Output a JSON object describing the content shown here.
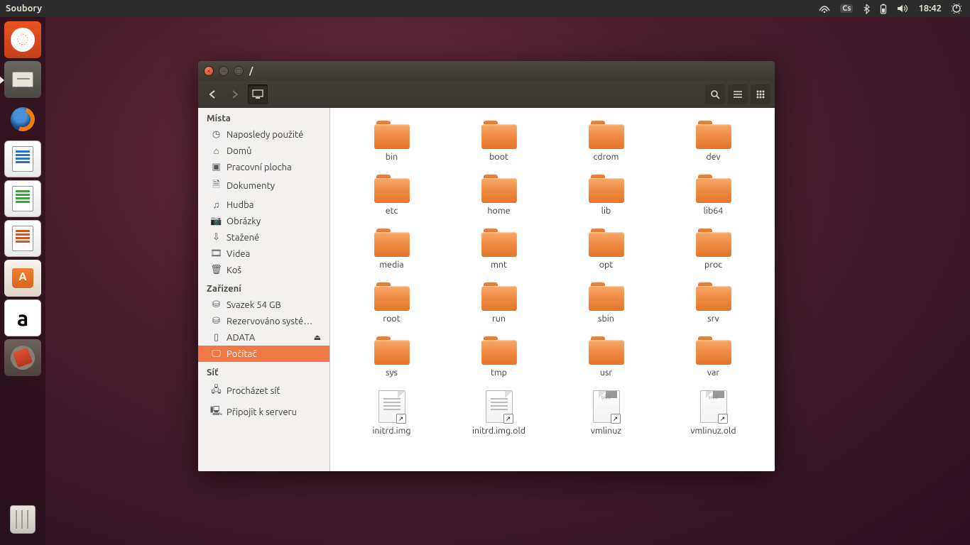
{
  "panel": {
    "app": "Soubory",
    "kbd": "Cs",
    "time": "18:42"
  },
  "window": {
    "title": "/"
  },
  "sidebar": {
    "sections": [
      {
        "head": "Místa",
        "items": [
          {
            "icon": "clock",
            "label": "Naposledy použité"
          },
          {
            "icon": "home",
            "label": "Domů"
          },
          {
            "icon": "desktop",
            "label": "Pracovní plocha"
          },
          {
            "icon": "doc",
            "label": "Dokumenty"
          },
          {
            "icon": "music",
            "label": "Hudba"
          },
          {
            "icon": "camera",
            "label": "Obrázky"
          },
          {
            "icon": "download",
            "label": "Stažené"
          },
          {
            "icon": "video",
            "label": "Videa"
          },
          {
            "icon": "trash",
            "label": "Koš"
          }
        ]
      },
      {
        "head": "Zařízení",
        "items": [
          {
            "icon": "disk",
            "label": "Svazek 54 GB"
          },
          {
            "icon": "disk",
            "label": "Rezervováno systé…"
          },
          {
            "icon": "phone",
            "label": "ADATA",
            "eject": true
          },
          {
            "icon": "computer",
            "label": "Počítač",
            "sel": true
          }
        ]
      },
      {
        "head": "Síť",
        "items": [
          {
            "icon": "net",
            "label": "Procházet síť"
          },
          {
            "icon": "server",
            "label": "Připojit k serveru"
          }
        ]
      }
    ]
  },
  "items": [
    {
      "name": "bin",
      "type": "folder"
    },
    {
      "name": "boot",
      "type": "folder"
    },
    {
      "name": "cdrom",
      "type": "folder"
    },
    {
      "name": "dev",
      "type": "folder"
    },
    {
      "name": "etc",
      "type": "folder"
    },
    {
      "name": "home",
      "type": "folder"
    },
    {
      "name": "lib",
      "type": "folder"
    },
    {
      "name": "lib64",
      "type": "folder"
    },
    {
      "name": "media",
      "type": "folder"
    },
    {
      "name": "mnt",
      "type": "folder"
    },
    {
      "name": "opt",
      "type": "folder"
    },
    {
      "name": "proc",
      "type": "folder"
    },
    {
      "name": "root",
      "type": "folder"
    },
    {
      "name": "run",
      "type": "folder"
    },
    {
      "name": "sbin",
      "type": "folder"
    },
    {
      "name": "srv",
      "type": "folder"
    },
    {
      "name": "sys",
      "type": "folder"
    },
    {
      "name": "tmp",
      "type": "folder"
    },
    {
      "name": "usr",
      "type": "folder"
    },
    {
      "name": "var",
      "type": "folder"
    },
    {
      "name": "initrd.img",
      "type": "link-txt"
    },
    {
      "name": "initrd.img.old",
      "type": "link-txt"
    },
    {
      "name": "vmlinuz",
      "type": "link-bin"
    },
    {
      "name": "vmlinuz.old",
      "type": "link-bin"
    }
  ]
}
